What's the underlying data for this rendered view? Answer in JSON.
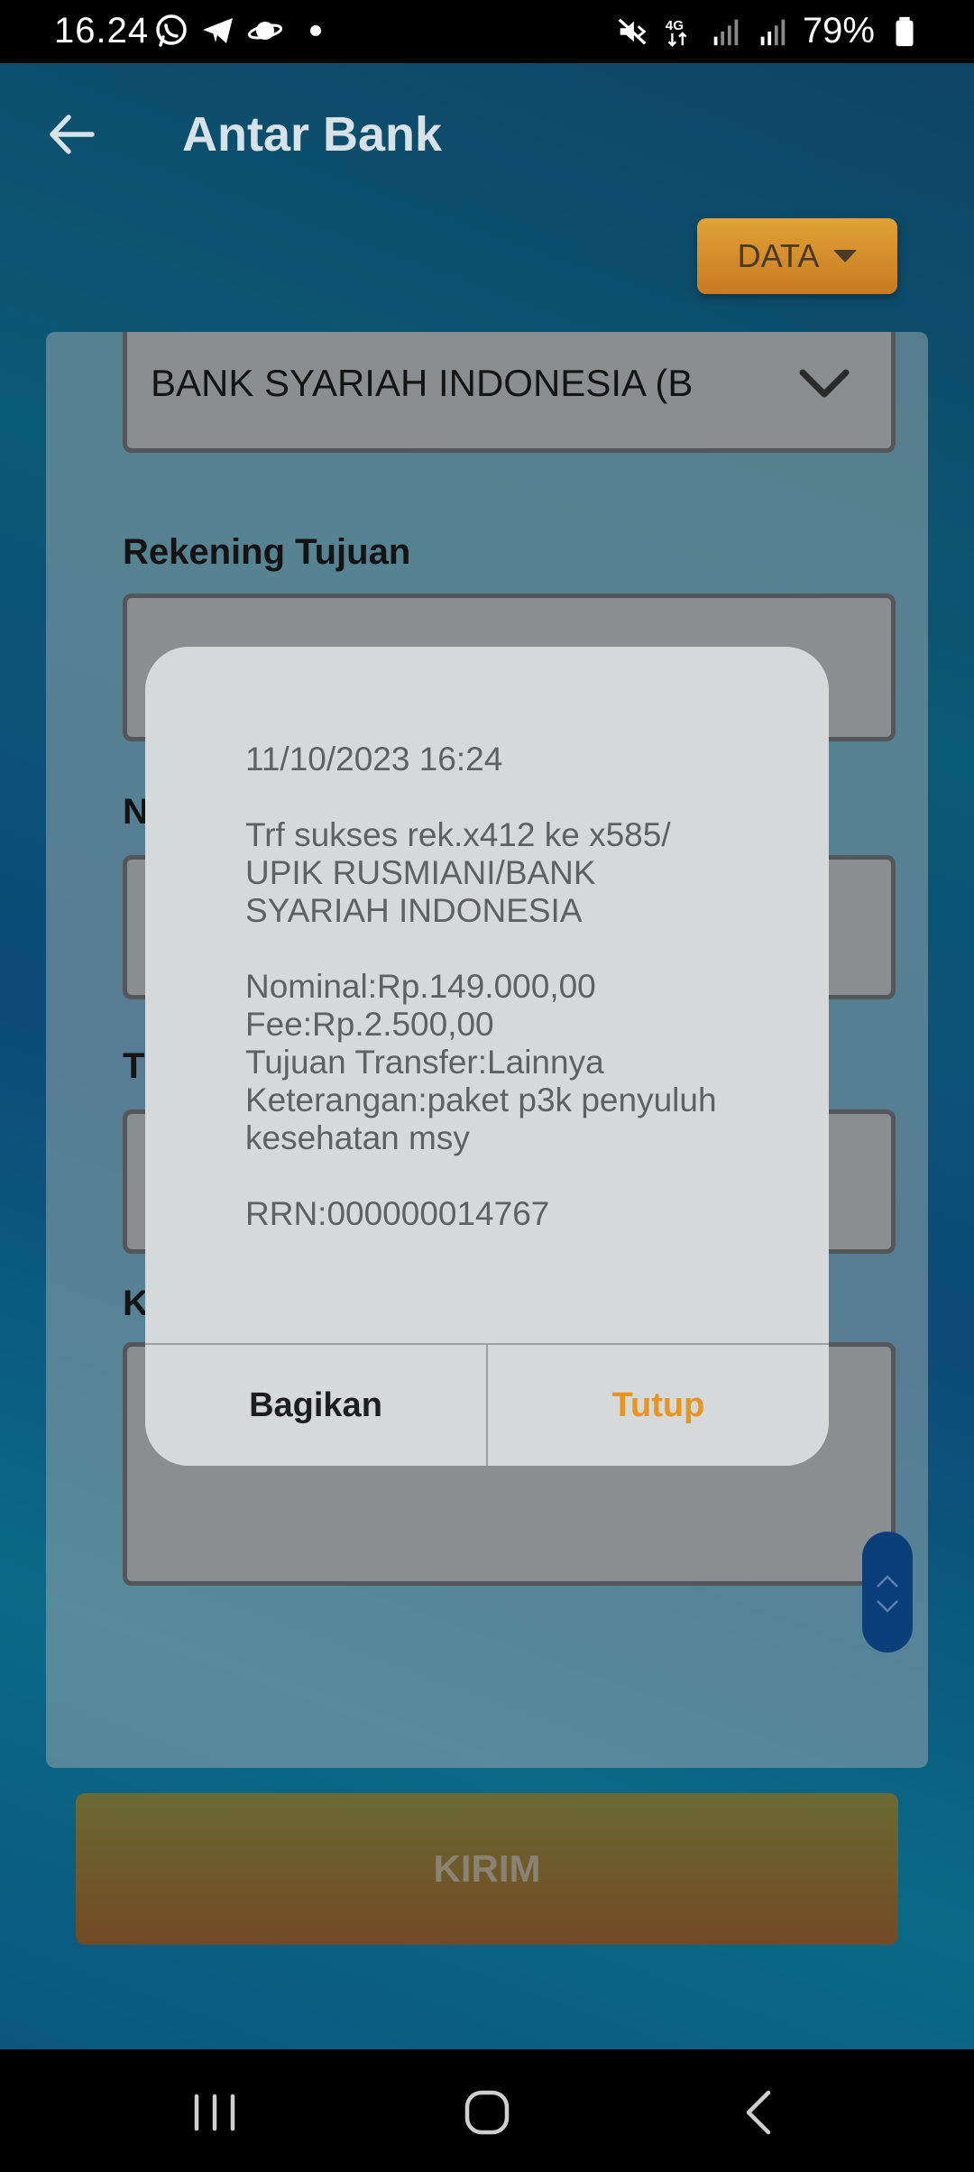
{
  "status_bar": {
    "time": "16.24",
    "battery": "79%",
    "app_icons": [
      "whatsapp-icon",
      "telegram-icon",
      "saturn-icon"
    ],
    "indicators": [
      "mute-icon",
      "4g-icon",
      "signal-icon",
      "signal-icon",
      "battery-icon"
    ]
  },
  "header": {
    "title": "Antar Bank",
    "back_icon": "arrow-left-icon"
  },
  "data_button": {
    "label": "DATA"
  },
  "form": {
    "bank_value": "BANK SYARIAH INDONESIA (B",
    "rekening_label": "Rekening Tujuan",
    "label_n": "N",
    "label_t": "T",
    "label_k": "K"
  },
  "submit": {
    "label": "KIRIM"
  },
  "dialog": {
    "line_1": "11/10/2023 16:24",
    "line_2": "Trf sukses rek.x412 ke x585/",
    "line_3": "UPIK RUSMIANI/BANK",
    "line_4": "SYARIAH INDONESIA",
    "line_5": "Nominal:Rp.149.000,00",
    "line_6": "Fee:Rp.2.500,00",
    "line_7": "Tujuan Transfer:Lainnya",
    "line_8": "Keterangan:paket p3k penyuluh",
    "line_9": "kesehatan msy",
    "line_10": "RRN:000000014767",
    "share_label": "Bagikan",
    "close_label": "Tutup"
  },
  "colors": {
    "accent_orange": "#e8941e",
    "data_button": "#d18b2c",
    "dialog_bg": "#d6d9da",
    "scroll_handle": "#0a3f7a"
  }
}
